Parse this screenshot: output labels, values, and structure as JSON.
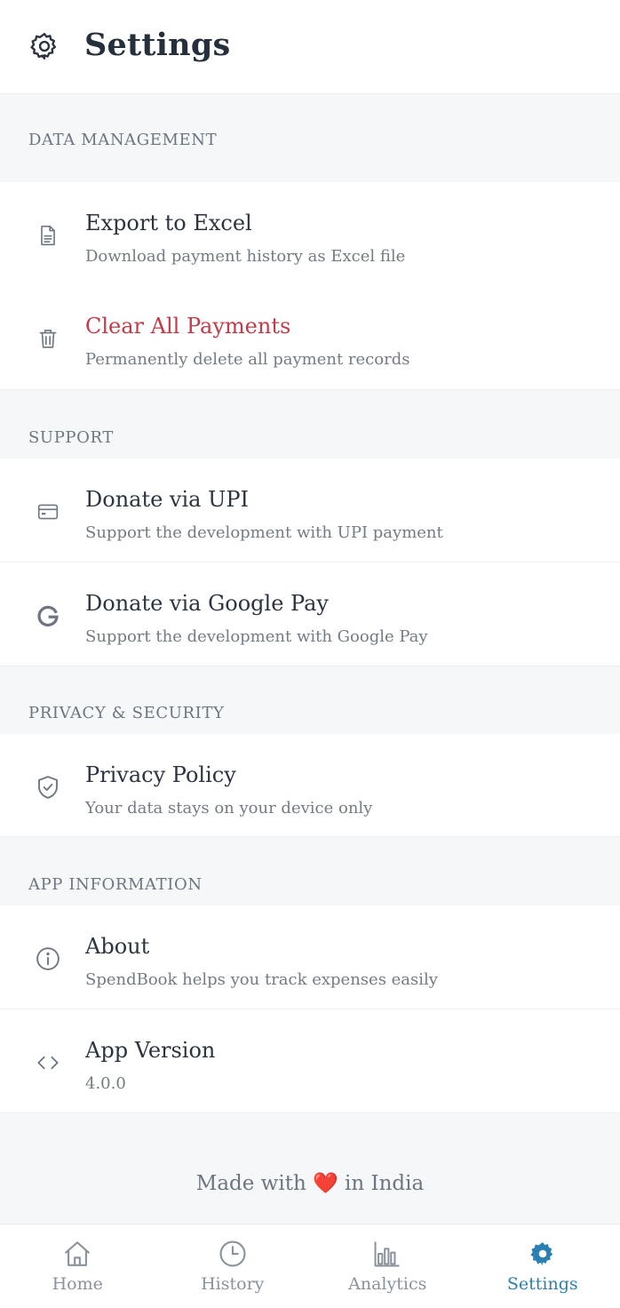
{
  "header": {
    "title": "Settings",
    "icon": "gear-icon"
  },
  "sections": {
    "data_management": {
      "label": "DATA MANAGEMENT",
      "items": [
        {
          "title": "Export to Excel",
          "subtitle": "Download payment history as Excel file",
          "icon": "file-icon"
        },
        {
          "title": "Clear All Payments",
          "subtitle": "Permanently delete all payment records",
          "icon": "trash-icon"
        }
      ]
    },
    "support": {
      "label": "SUPPORT",
      "items": [
        {
          "title": "Donate via UPI",
          "subtitle": "Support the development with UPI payment",
          "icon": "card-icon"
        },
        {
          "title": "Donate via Google Pay",
          "subtitle": "Support the development with Google Pay",
          "icon": "google-icon"
        }
      ]
    },
    "privacy": {
      "label": "PRIVACY & SECURITY",
      "items": [
        {
          "title": "Privacy Policy",
          "subtitle": "Your data stays on your device only",
          "icon": "shield-check-icon"
        }
      ]
    },
    "app_info": {
      "label": "APP INFORMATION",
      "items": [
        {
          "title": "About",
          "subtitle": "SpendBook helps you track expenses easily",
          "icon": "info-icon"
        },
        {
          "title": "App Version",
          "subtitle": "4.0.0",
          "icon": "code-icon"
        }
      ]
    }
  },
  "footer": {
    "prefix": "Made with",
    "heart": "❤️",
    "suffix": "in India"
  },
  "tabs": [
    {
      "label": "Home",
      "icon": "home-icon",
      "active": false
    },
    {
      "label": "History",
      "icon": "clock-icon",
      "active": false
    },
    {
      "label": "Analytics",
      "icon": "bar-chart-icon",
      "active": false
    },
    {
      "label": "Settings",
      "icon": "gear-icon",
      "active": true
    }
  ],
  "colors": {
    "danger": "#c43a48",
    "accent": "#2c7fb2",
    "muted": "#737b84"
  }
}
